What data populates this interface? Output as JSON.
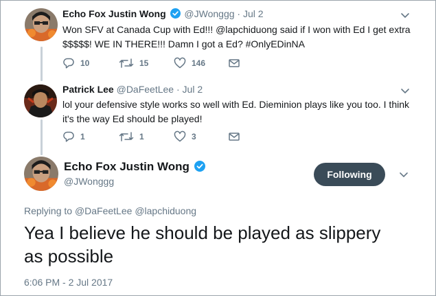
{
  "tweets": [
    {
      "name": "Echo Fox Justin Wong",
      "handle": "@JWonggg",
      "dot": "·",
      "date": "Jul 2",
      "text_line1": "Won SFV at Canada Cup with Ed!!! @lapchiduong said if I won with Ed I get extra",
      "text_line2": "$$$$$! WE IN THERE!!! Damn I got a Ed? #OnlyEDinNA",
      "replies": "10",
      "retweets": "15",
      "likes": "146"
    },
    {
      "name": "Patrick Lee",
      "handle": "@DaFeetLee",
      "dot": "·",
      "date": "Jul 2",
      "text_line1": "lol your defensive style works so well with Ed. Dieminion plays like you too. I think",
      "text_line2": "it's the way Ed should be played!",
      "replies": "1",
      "retweets": "1",
      "likes": "3"
    }
  ],
  "main_tweet": {
    "name": "Echo Fox Justin Wong",
    "handle": "@JWonggg",
    "follow_label": "Following",
    "replying_prefix": "Replying to",
    "replying_to_1": "@DaFeetLee",
    "replying_to_2": "@lapchiduong",
    "text_line1": "Yea I believe he should be played as slippery",
    "text_line2": "as possible",
    "timestamp": "6:06 PM - 2 Jul 2017"
  },
  "colors": {
    "verified": "#1da1f2",
    "muted": "#657786",
    "follow_button": "#3a4b58",
    "thread_line": "#c8d1d8"
  },
  "icons": [
    "reply-icon",
    "retweet-icon",
    "like-icon",
    "message-icon",
    "chevron-down-icon",
    "verified-badge-icon"
  ]
}
